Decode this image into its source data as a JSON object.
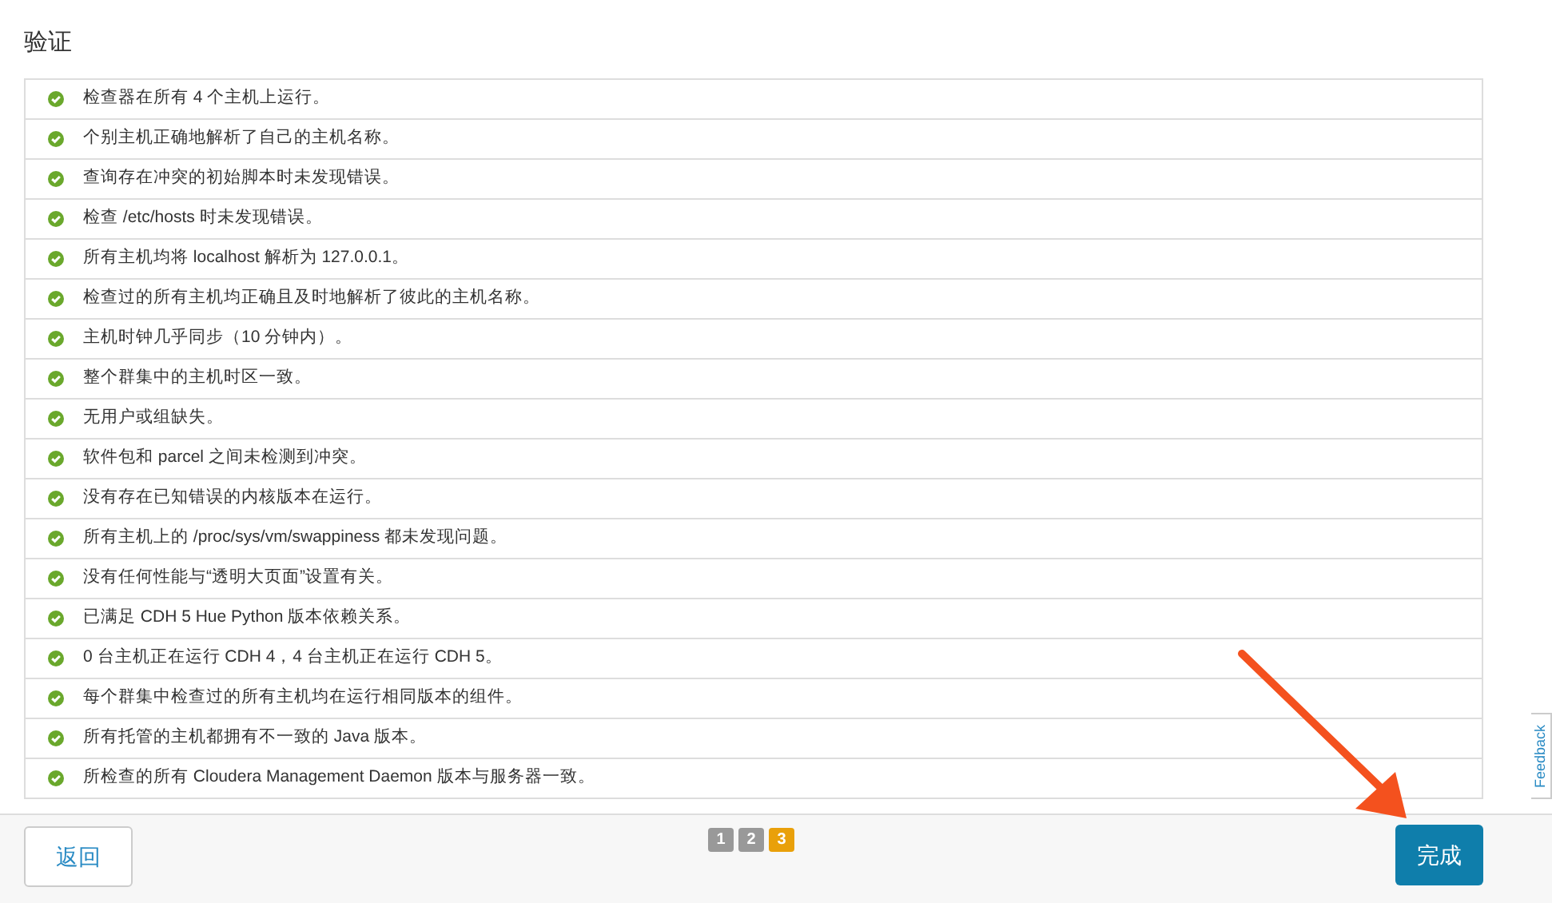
{
  "heading": "验证",
  "checks": [
    {
      "text": "检查器在所有 4 个主机上运行。"
    },
    {
      "text": "个别主机正确地解析了自己的主机名称。"
    },
    {
      "text": "查询存在冲突的初始脚本时未发现错误。"
    },
    {
      "text": "检查 /etc/hosts 时未发现错误。"
    },
    {
      "text": "所有主机均将 localhost 解析为 127.0.0.1。"
    },
    {
      "text": "检查过的所有主机均正确且及时地解析了彼此的主机名称。"
    },
    {
      "text": "主机时钟几乎同步（10 分钟内）。"
    },
    {
      "text": "整个群集中的主机时区一致。"
    },
    {
      "text": "无用户或组缺失。"
    },
    {
      "text": "软件包和 parcel 之间未检测到冲突。"
    },
    {
      "text": "没有存在已知错误的内核版本在运行。"
    },
    {
      "text": "所有主机上的 /proc/sys/vm/swappiness 都未发现问题。"
    },
    {
      "text": "没有任何性能与“透明大页面”设置有关。"
    },
    {
      "text": "已满足 CDH 5 Hue Python 版本依赖关系。"
    },
    {
      "text": "0 台主机正在运行 CDH 4，4 台主机正在运行 CDH 5。"
    },
    {
      "text": "每个群集中检查过的所有主机均在运行相同版本的组件。"
    },
    {
      "text": "所有托管的主机都拥有不一致的 Java 版本。"
    },
    {
      "text": "所检查的所有 Cloudera Management Daemon 版本与服务器一致。"
    }
  ],
  "back_button": "返回",
  "pages": [
    {
      "label": "1",
      "selected": false
    },
    {
      "label": "2",
      "selected": false
    },
    {
      "label": "3",
      "selected": true
    }
  ],
  "finish_button": "完成",
  "feedback_tab": "Feedback"
}
